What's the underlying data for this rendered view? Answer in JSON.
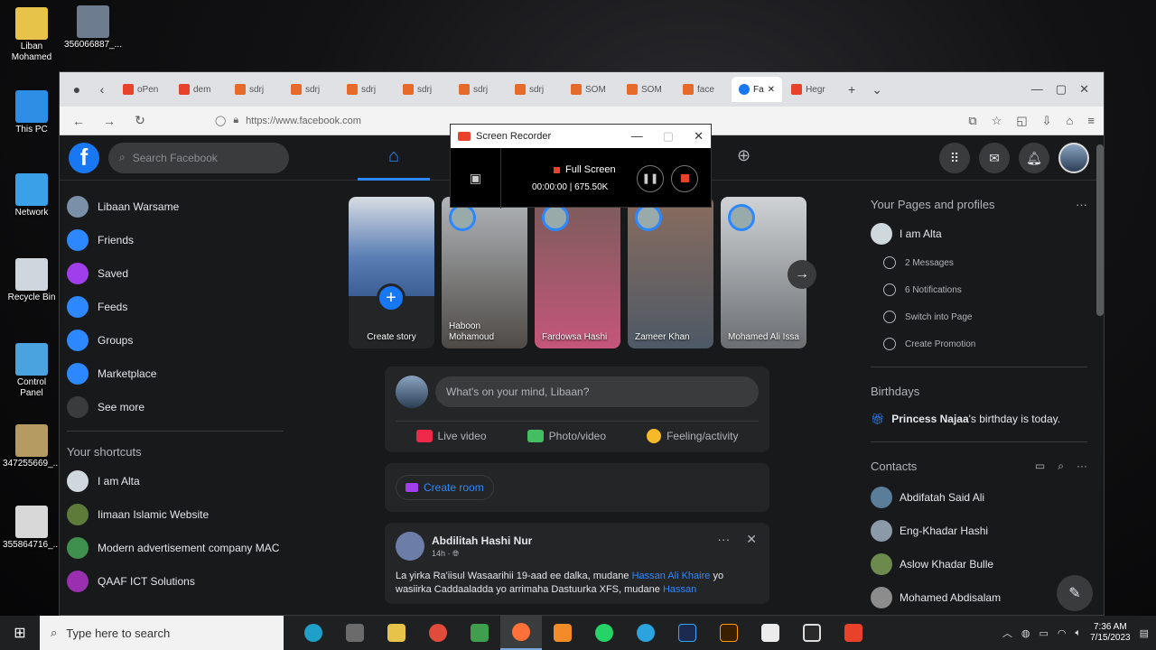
{
  "desktop": {
    "icons": [
      {
        "label": "Liban\nMohamed",
        "color": "#e8c34a"
      },
      {
        "label": "356066887_...",
        "color": "#6d7c8f"
      },
      {
        "label": "This PC",
        "color": "#2e8ee6"
      },
      {
        "label": "Network",
        "color": "#3aa0e8"
      },
      {
        "label": "Recycle Bin",
        "color": "#cfd6de"
      },
      {
        "label": "Control\nPanel",
        "color": "#4aa3df"
      },
      {
        "label": "347255669_...",
        "color": "#b59a62"
      },
      {
        "label": "355864716_...",
        "color": "#d8d8d8"
      }
    ]
  },
  "browser": {
    "tabs": [
      "oPen",
      "dem",
      "sdrj",
      "sdrj",
      "sdrj",
      "sdrj",
      "sdrj",
      "sdrj",
      "SOM",
      "SOM",
      "face",
      "Fa",
      "Hegr"
    ],
    "url": "https://www.facebook.com"
  },
  "facebook": {
    "search_placeholder": "Search Facebook",
    "left_nav": [
      "Libaan Warsame",
      "Friends",
      "Saved",
      "Feeds",
      "Groups",
      "Marketplace",
      "See more"
    ],
    "shortcuts_title": "Your shortcuts",
    "shortcuts": [
      "I am Alta",
      "Iimaan Islamic Website",
      "Modern advertisement company MAC",
      "QAAF ICT Solutions"
    ],
    "stories": [
      {
        "name": "Create story"
      },
      {
        "name": "Haboon Mohamoud"
      },
      {
        "name": "Fardowsa Hashi"
      },
      {
        "name": "Zameer Khan"
      },
      {
        "name": "Mohamed Ali Issa"
      }
    ],
    "composer": {
      "placeholder": "What's on your mind, Libaan?",
      "live": "Live video",
      "photo": "Photo/video",
      "feeling": "Feeling/activity"
    },
    "create_room": "Create room",
    "post": {
      "author": "Abdilitah Hashi Nur",
      "time": "14h",
      "text_a": "La yirka Ra'iisul Wasaarihii 19-aad ee dalka, mudane ",
      "link_a": "Hassan Ali Khaire",
      "text_b": " yo wasiirka Caddaaladda yo arrimaha Dastuurka XFS, mudane ",
      "link_b": "Hassan"
    },
    "right": {
      "pages_title": "Your Pages and profiles",
      "page_name": "I am Alta",
      "page_actions": [
        "2 Messages",
        "6 Notifications",
        "Switch into Page",
        "Create Promotion"
      ],
      "birthdays_title": "Birthdays",
      "birthday_name": "Princess Najaa",
      "birthday_suffix": "'s birthday is today.",
      "contacts_title": "Contacts",
      "contacts": [
        "Abdifatah Said Ali",
        "Eng-Khadar Hashi",
        "Aslow Khadar Bulle",
        "Mohamed Abdisalam"
      ]
    }
  },
  "recorder": {
    "title": "Screen Recorder",
    "mode": "Full Screen",
    "time": "00:00:00",
    "size": "675.50K"
  },
  "taskbar": {
    "search_placeholder": "Type here to search",
    "time": "7:36 AM",
    "date": "7/15/2023"
  }
}
